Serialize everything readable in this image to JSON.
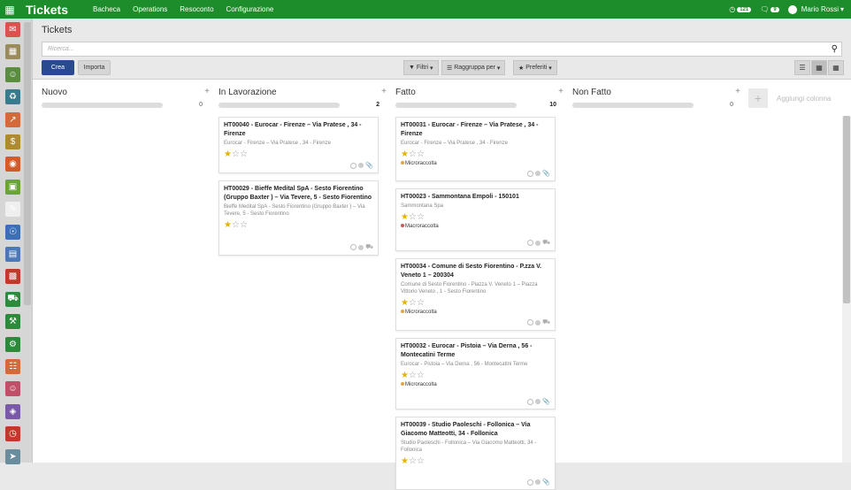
{
  "topbar": {
    "title": "Tickets",
    "menu": [
      "Bacheca",
      "Operations",
      "Resoconto",
      "Configurazione"
    ],
    "activity_count": "121",
    "message_count": "9",
    "user": "Mario Rossi"
  },
  "sidebar_icons": [
    {
      "name": "discuss-icon",
      "color": "#d9534f"
    },
    {
      "name": "calendar-icon",
      "color": "#9a8b5a"
    },
    {
      "name": "contacts-icon",
      "color": "#5a8d3e"
    },
    {
      "name": "crm-icon",
      "color": "#3a7a8e"
    },
    {
      "name": "sales-icon",
      "color": "#d46a3a"
    },
    {
      "name": "invoicing-icon",
      "color": "#b08a2f"
    },
    {
      "name": "website-icon",
      "color": "#d45a2a"
    },
    {
      "name": "project-icon",
      "color": "#6aa336"
    },
    {
      "name": "documents-icon",
      "color": "#efefef"
    },
    {
      "name": "helpdesk-icon",
      "color": "#3b6fb7"
    },
    {
      "name": "payment-icon",
      "color": "#4a78b8"
    },
    {
      "name": "inventory-icon",
      "color": "#c0392b"
    },
    {
      "name": "delivery-icon",
      "color": "#2e8b3e"
    },
    {
      "name": "tools-icon",
      "color": "#2d8a3a"
    },
    {
      "name": "repair-icon",
      "color": "#2d8a3a"
    },
    {
      "name": "report-icon",
      "color": "#d46a3a"
    },
    {
      "name": "employees-icon",
      "color": "#c0506a"
    },
    {
      "name": "apps-icon",
      "color": "#7a5aa8"
    },
    {
      "name": "timer-icon",
      "color": "#c0392b"
    },
    {
      "name": "send-icon",
      "color": "#6a8d9e"
    }
  ],
  "control_panel": {
    "breadcrumb": "Tickets",
    "search_placeholder": "Ricerca...",
    "create_label": "Crea",
    "import_label": "Importa",
    "filters_label": "Filtri",
    "groupby_label": "Raggruppa per",
    "favorites_label": "Preferiti"
  },
  "columns": [
    {
      "title": "Nuovo",
      "count": "0",
      "cards": []
    },
    {
      "title": "In Lavorazione",
      "count": "2",
      "cards": [
        {
          "title": "HT00040 - Eurocar - Firenze – Via Pratese , 34 - Firenze",
          "sub": "Eurocar - Firenze – Via Pratese , 34 - Firenze",
          "rating": 1,
          "tag": "",
          "tag_color": "",
          "icon": "attachment-icon"
        },
        {
          "title": "HT00029 - Bieffe Medital SpA - Sesto Fiorentino (Gruppo Baxter ) – Via Tevere, 5 - Sesto Fiorentino",
          "sub": "Bieffe Medital SpA - Sesto Fiorentino (Gruppo Baxter ) – Via Tevere, 5 - Sesto Fiorentino",
          "rating": 1,
          "tag": "",
          "tag_color": "",
          "icon": "truck-icon"
        }
      ]
    },
    {
      "title": "Fatto",
      "count": "10",
      "cards": [
        {
          "title": "HT00031 - Eurocar - Firenze – Via Pratese , 34 - Firenze",
          "sub": "Eurocar - Firenze – Via Pratese , 34 - Firenze",
          "rating": 1,
          "tag": "Microraccolta",
          "tag_color": "#e8a33a",
          "icon": "attachment-icon"
        },
        {
          "title": "HT00023 - Sammontana Empoli - 150101",
          "sub": "Sammontana Spa",
          "rating": 1,
          "tag": "Macroraccolta",
          "tag_color": "#d9534f",
          "icon": "truck-icon"
        },
        {
          "title": "HT00034 - Comune di Sesto Fiorentino - P.zza V. Veneto 1 – 200304",
          "sub": "Comune di Sesto Fiorentino - Piazza V. Veneto 1 – Piazza Vittorio Veneto , 1 - Sesto Fiorentino",
          "rating": 1,
          "tag": "Microraccolta",
          "tag_color": "#e8a33a",
          "icon": "truck-icon"
        },
        {
          "title": "HT00032 - Eurocar - Pistoia – Via Derna , 56 - Montecatini Terme",
          "sub": "Eurocar - Pistoia – Via Derna , 56 - Montecatini Terme",
          "rating": 1,
          "tag": "Microraccolta",
          "tag_color": "#e8a33a",
          "icon": "attachment-icon"
        },
        {
          "title": "HT00039 - Studio Paoleschi - Follonica – Via Giacomo Matteotti, 34 - Follonica",
          "sub": "Studio Paoleschi - Follonica – Via Giacomo Matteotti, 34 - Follonica",
          "rating": 1,
          "tag": "",
          "tag_color": "",
          "icon": "attachment-icon"
        }
      ]
    },
    {
      "title": "Non Fatto",
      "count": "0",
      "cards": []
    }
  ],
  "add_column_label": "Aggiungi colonna"
}
